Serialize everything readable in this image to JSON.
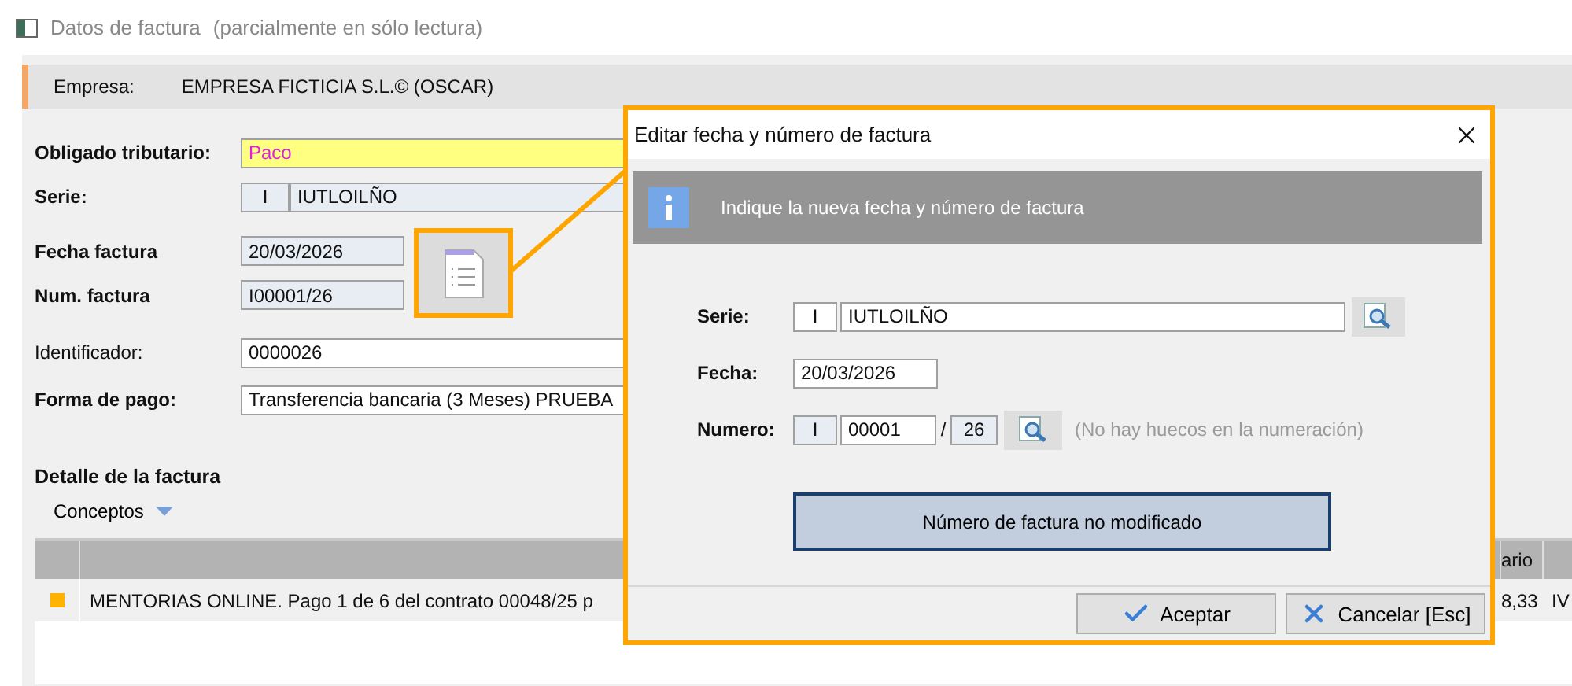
{
  "window": {
    "title": "Datos de factura",
    "subtitle": "(parcialmente en sólo lectura)"
  },
  "empresa": {
    "label": "Empresa:",
    "value": "EMPRESA FICTICIA S.L.© (OSCAR)"
  },
  "form": {
    "obligado": {
      "label": "Obligado tributario:",
      "value": "Paco"
    },
    "serie": {
      "label": "Serie:",
      "code": "I",
      "name": "IUTLOILÑO"
    },
    "fecha": {
      "label": "Fecha factura",
      "value": "20/03/2026"
    },
    "numero": {
      "label": "Num. factura",
      "value": "I00001/26"
    },
    "identificador": {
      "label": "Identificador:",
      "value": "0000026"
    },
    "forma_pago": {
      "label": "Forma de pago:",
      "value": "Transferencia bancaria (3 Meses) PRUEBA"
    }
  },
  "detail": {
    "title": "Detalle de la factura",
    "menu": "Conceptos",
    "table": {
      "header_column_3": "ario",
      "rows": [
        {
          "color": "#ffb300",
          "description": "MENTORIAS ONLINE. Pago 1 de 6 del contrato 00048/25 p",
          "column_3": "8,33",
          "column_4": "IV"
        }
      ]
    }
  },
  "dialog": {
    "title": "Editar fecha y número de factura",
    "info": "Indique la nueva fecha y número de factura",
    "serie": {
      "label": "Serie:",
      "code": "I",
      "name": "IUTLOILÑO"
    },
    "fecha": {
      "label": "Fecha:",
      "value": "20/03/2026"
    },
    "numero": {
      "label": "Numero:",
      "code": "I",
      "number": "00001",
      "separator": "/",
      "year": "26",
      "hint": "(No hay huecos en la numeración)"
    },
    "status": "Número de factura no modificado",
    "buttons": [
      {
        "label": "Aceptar",
        "kind": "accept"
      },
      {
        "label": "Cancelar [Esc]",
        "kind": "cancel"
      }
    ]
  }
}
